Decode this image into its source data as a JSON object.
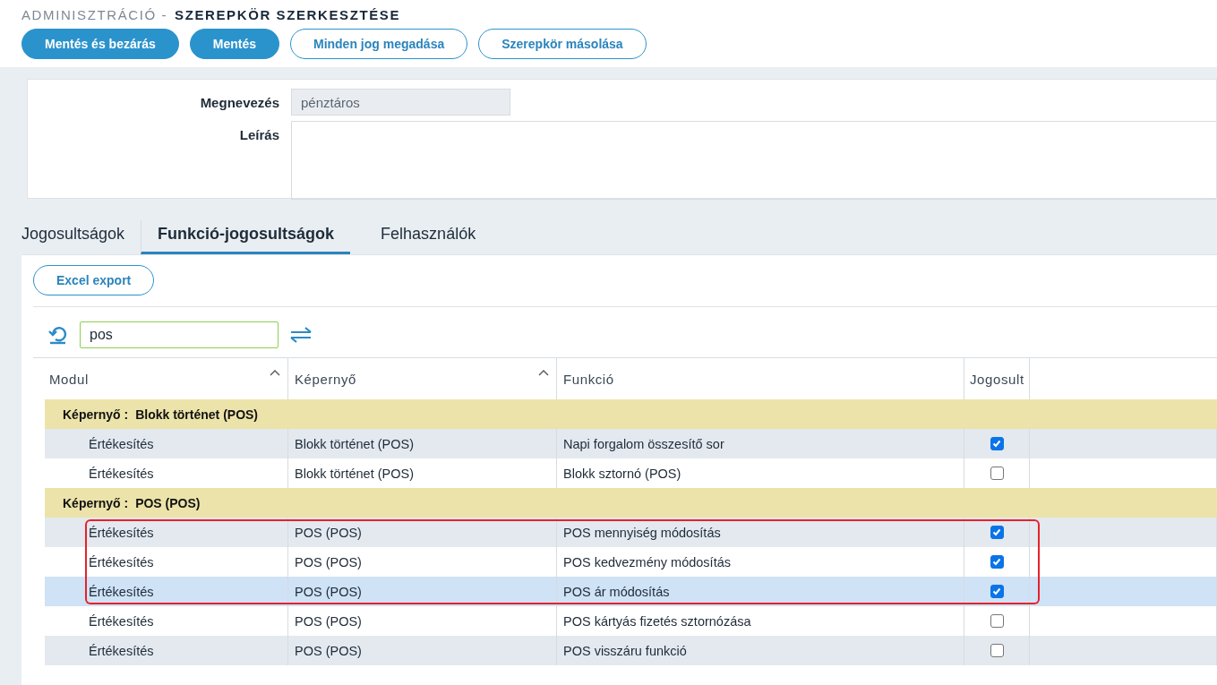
{
  "breadcrumb": {
    "section": "ADMINISZTRÁCIÓ -",
    "page": "SZEREPKÖR SZERKESZTÉSE"
  },
  "actions": [
    {
      "label": "Mentés és bezárás",
      "kind": "primary"
    },
    {
      "label": "Mentés",
      "kind": "primary"
    },
    {
      "label": "Minden jog megadása",
      "kind": "outline"
    },
    {
      "label": "Szerepkör másolása",
      "kind": "outline"
    }
  ],
  "form": {
    "name_label": "Megnevezés",
    "name_value": "pénztáros",
    "description_label": "Leírás"
  },
  "tabs": [
    {
      "label": "Jogosultságok",
      "selected": false
    },
    {
      "label": "Funkció-jogosultságok",
      "selected": true
    },
    {
      "label": "Felhasználók",
      "selected": false
    }
  ],
  "export_button": "Excel export",
  "filter": {
    "value": "pos"
  },
  "table": {
    "columns": [
      {
        "label": "Modul",
        "sortable": true
      },
      {
        "label": "Képernyő",
        "sortable": true
      },
      {
        "label": "Funkció",
        "sortable": false
      },
      {
        "label": "Jogosult"
      }
    ],
    "rows": [
      {
        "kind": "group",
        "label": "Képernyő :",
        "value": "Blokk történet (POS)"
      },
      {
        "kind": "row",
        "module": "Értékesítés",
        "screen": "Blokk történet (POS)",
        "function": "Napi forgalom összesítő sor",
        "checked": true,
        "selected": false,
        "highlighted": false
      },
      {
        "kind": "row",
        "module": "Értékesítés",
        "screen": "Blokk történet (POS)",
        "function": "Blokk sztornó (POS)",
        "checked": false,
        "selected": false,
        "highlighted": false
      },
      {
        "kind": "group",
        "label": "Képernyő :",
        "value": "POS (POS)"
      },
      {
        "kind": "row",
        "module": "Értékesítés",
        "screen": "POS (POS)",
        "function": "POS mennyiség módosítás",
        "checked": true,
        "selected": false,
        "highlighted": true
      },
      {
        "kind": "row",
        "module": "Értékesítés",
        "screen": "POS (POS)",
        "function": "POS kedvezmény módosítás",
        "checked": true,
        "selected": false,
        "highlighted": true
      },
      {
        "kind": "row",
        "module": "Értékesítés",
        "screen": "POS (POS)",
        "function": "POS ár módosítás",
        "checked": true,
        "selected": true,
        "highlighted": true
      },
      {
        "kind": "row",
        "module": "Értékesítés",
        "screen": "POS (POS)",
        "function": "POS kártyás fizetés sztornózása",
        "checked": false,
        "selected": false,
        "highlighted": false
      },
      {
        "kind": "row",
        "module": "Értékesítés",
        "screen": "POS (POS)",
        "function": "POS visszáru funkció",
        "checked": false,
        "selected": false,
        "highlighted": false
      }
    ]
  }
}
